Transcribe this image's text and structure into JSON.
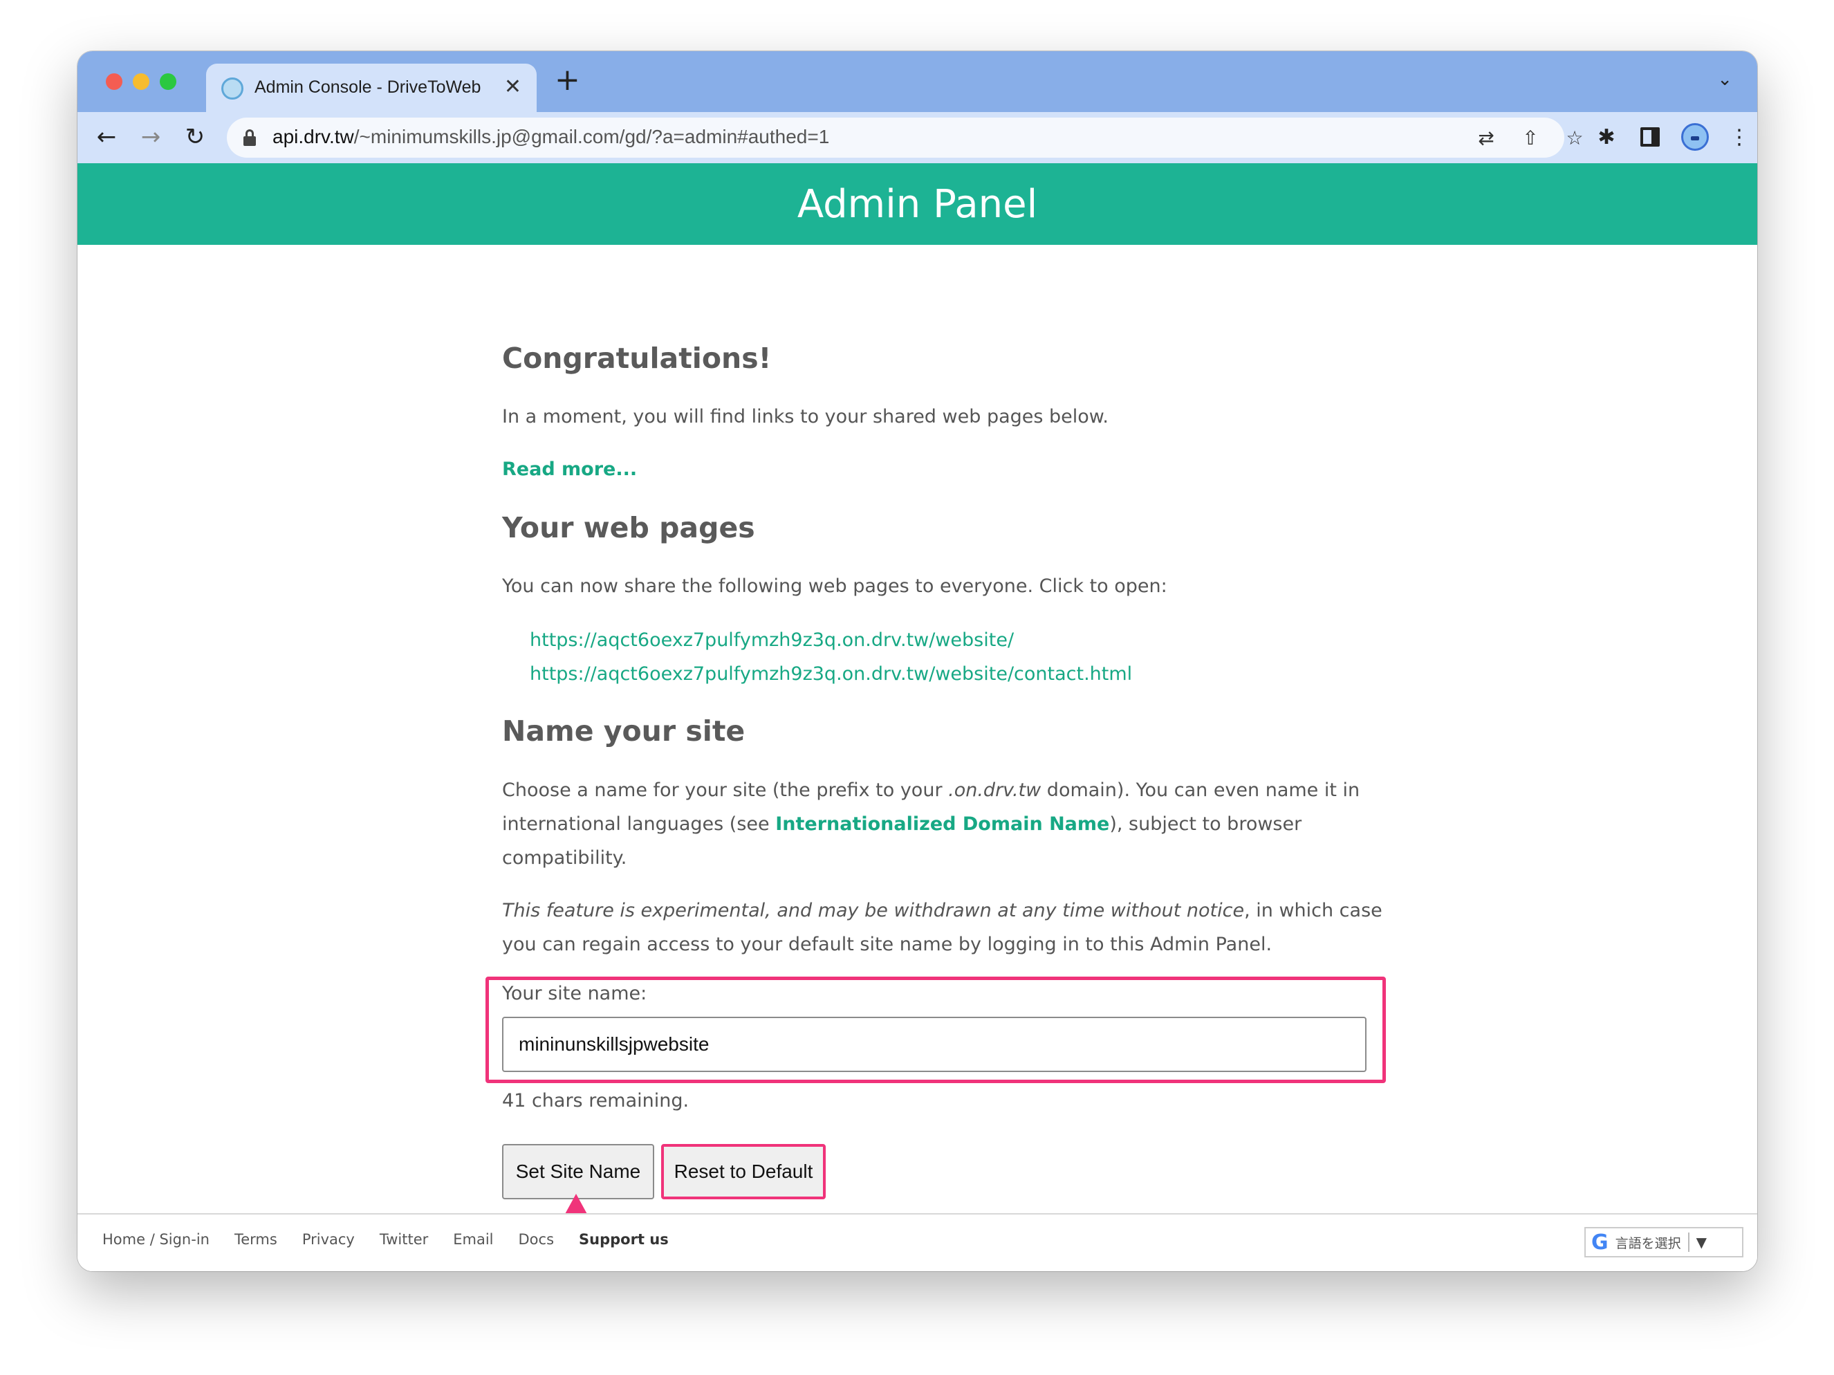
{
  "browser": {
    "tab_title": "Admin Console - DriveToWeb",
    "tab_close": "✕",
    "new_tab": "+",
    "tab_menu": "⌄",
    "url_host": "api.drv.tw",
    "url_path": "/~minimumskills.jp@gmail.com/gd/?a=admin#authed=1",
    "icons": {
      "back": "←",
      "forward": "→",
      "reload": "↻",
      "translate": "⇄",
      "share": "⇧",
      "star": "☆",
      "extensions": "✱",
      "menu": "⋮"
    }
  },
  "header": {
    "title": "Admin Panel",
    "color": "#1db394"
  },
  "congrats": {
    "heading": "Congratulations!",
    "text": "In a moment, you will find links to your shared web pages below.",
    "read_more": "Read more..."
  },
  "web_pages": {
    "heading": "Your web pages",
    "text": "You can now share the following web pages to everyone. Click to open:",
    "links": [
      "https://aqct6oexz7pulfymzh9z3q.on.drv.tw/website/",
      "https://aqct6oexz7pulfymzh9z3q.on.drv.tw/website/contact.html"
    ]
  },
  "name_site": {
    "heading": "Name your site",
    "p1_a": "Choose a name for your site (the prefix to your ",
    "p1_domain": ".on.drv.tw",
    "p1_b": " domain). You can even name it in",
    "p2_a": "international languages (see ",
    "p2_link": "Internationalized Domain Name",
    "p2_b": "), subject to browser",
    "p3": "compatibility.",
    "exp_italic": "This feature is experimental, and may be withdrawn at any time without notice",
    "exp_rest": ", in which case",
    "exp_line2": "you can regain access to your default site name by logging in to this Admin Panel.",
    "label": "Your site name:",
    "value": "mininunskillsjpwebsite",
    "remaining": "41 chars remaining.",
    "set_button": "Set Site Name",
    "reset_button": "Reset to Default",
    "highlight_color": "#f0337a"
  },
  "footer": {
    "links": [
      "Home / Sign-in",
      "Terms",
      "Privacy",
      "Twitter",
      "Email",
      "Docs"
    ],
    "support": "Support us",
    "lang_g": "G",
    "lang_text": "言語を選択",
    "lang_arrow": "▼"
  }
}
